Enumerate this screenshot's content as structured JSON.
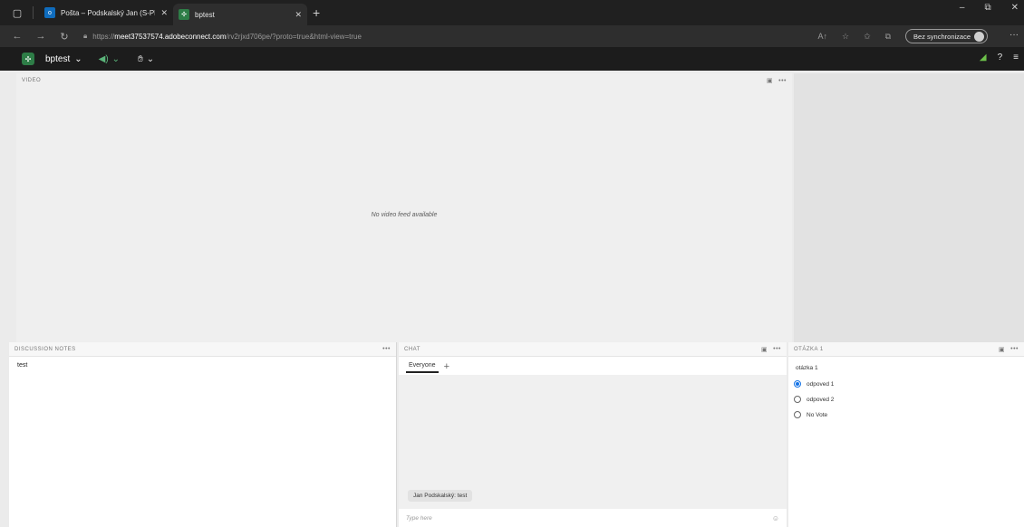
{
  "browser": {
    "tabs": [
      {
        "label": "Pošta – Podskalský Jan (S-PEF) –",
        "favicon": "outlook-icon",
        "color": "#0f6cbd"
      },
      {
        "label": "bptest",
        "favicon": "adobe-connect-icon",
        "color": "#2e7d47"
      }
    ],
    "new_tab": "+",
    "address": {
      "scheme": "https://",
      "host": "meet37537574.adobeconnect.com",
      "path": "/rv2rjxd706pe/?proto=true&html-view=true"
    },
    "sync_label": "Bez synchronizace",
    "win_min": "–",
    "win_restore": "⧉",
    "win_close": "✕"
  },
  "connect": {
    "meeting_name": "bptest",
    "audio_icon": "speaker-icon",
    "hand_icon": "raise-hand-icon"
  },
  "video_pod": {
    "title": "VIDEO",
    "message": "No video feed available"
  },
  "notes_pod": {
    "title": "DISCUSSION NOTES",
    "content": "test"
  },
  "chat_pod": {
    "title": "CHAT",
    "tab_label": "Everyone",
    "add_tab": "+",
    "messages": [
      {
        "text": "Jan Podskalský: test"
      }
    ],
    "input_placeholder": "Type here"
  },
  "poll_pod": {
    "title": "OTÁZKA 1",
    "question": "otázka 1",
    "options": [
      {
        "label": "odpoved 1",
        "selected": true
      },
      {
        "label": "odpoved 2",
        "selected": false
      },
      {
        "label": "No Vote",
        "selected": false
      }
    ]
  },
  "colors": {
    "accent_blue": "#1473e6",
    "connect_green": "#2e7d47",
    "signal_green": "#6cc04a"
  }
}
